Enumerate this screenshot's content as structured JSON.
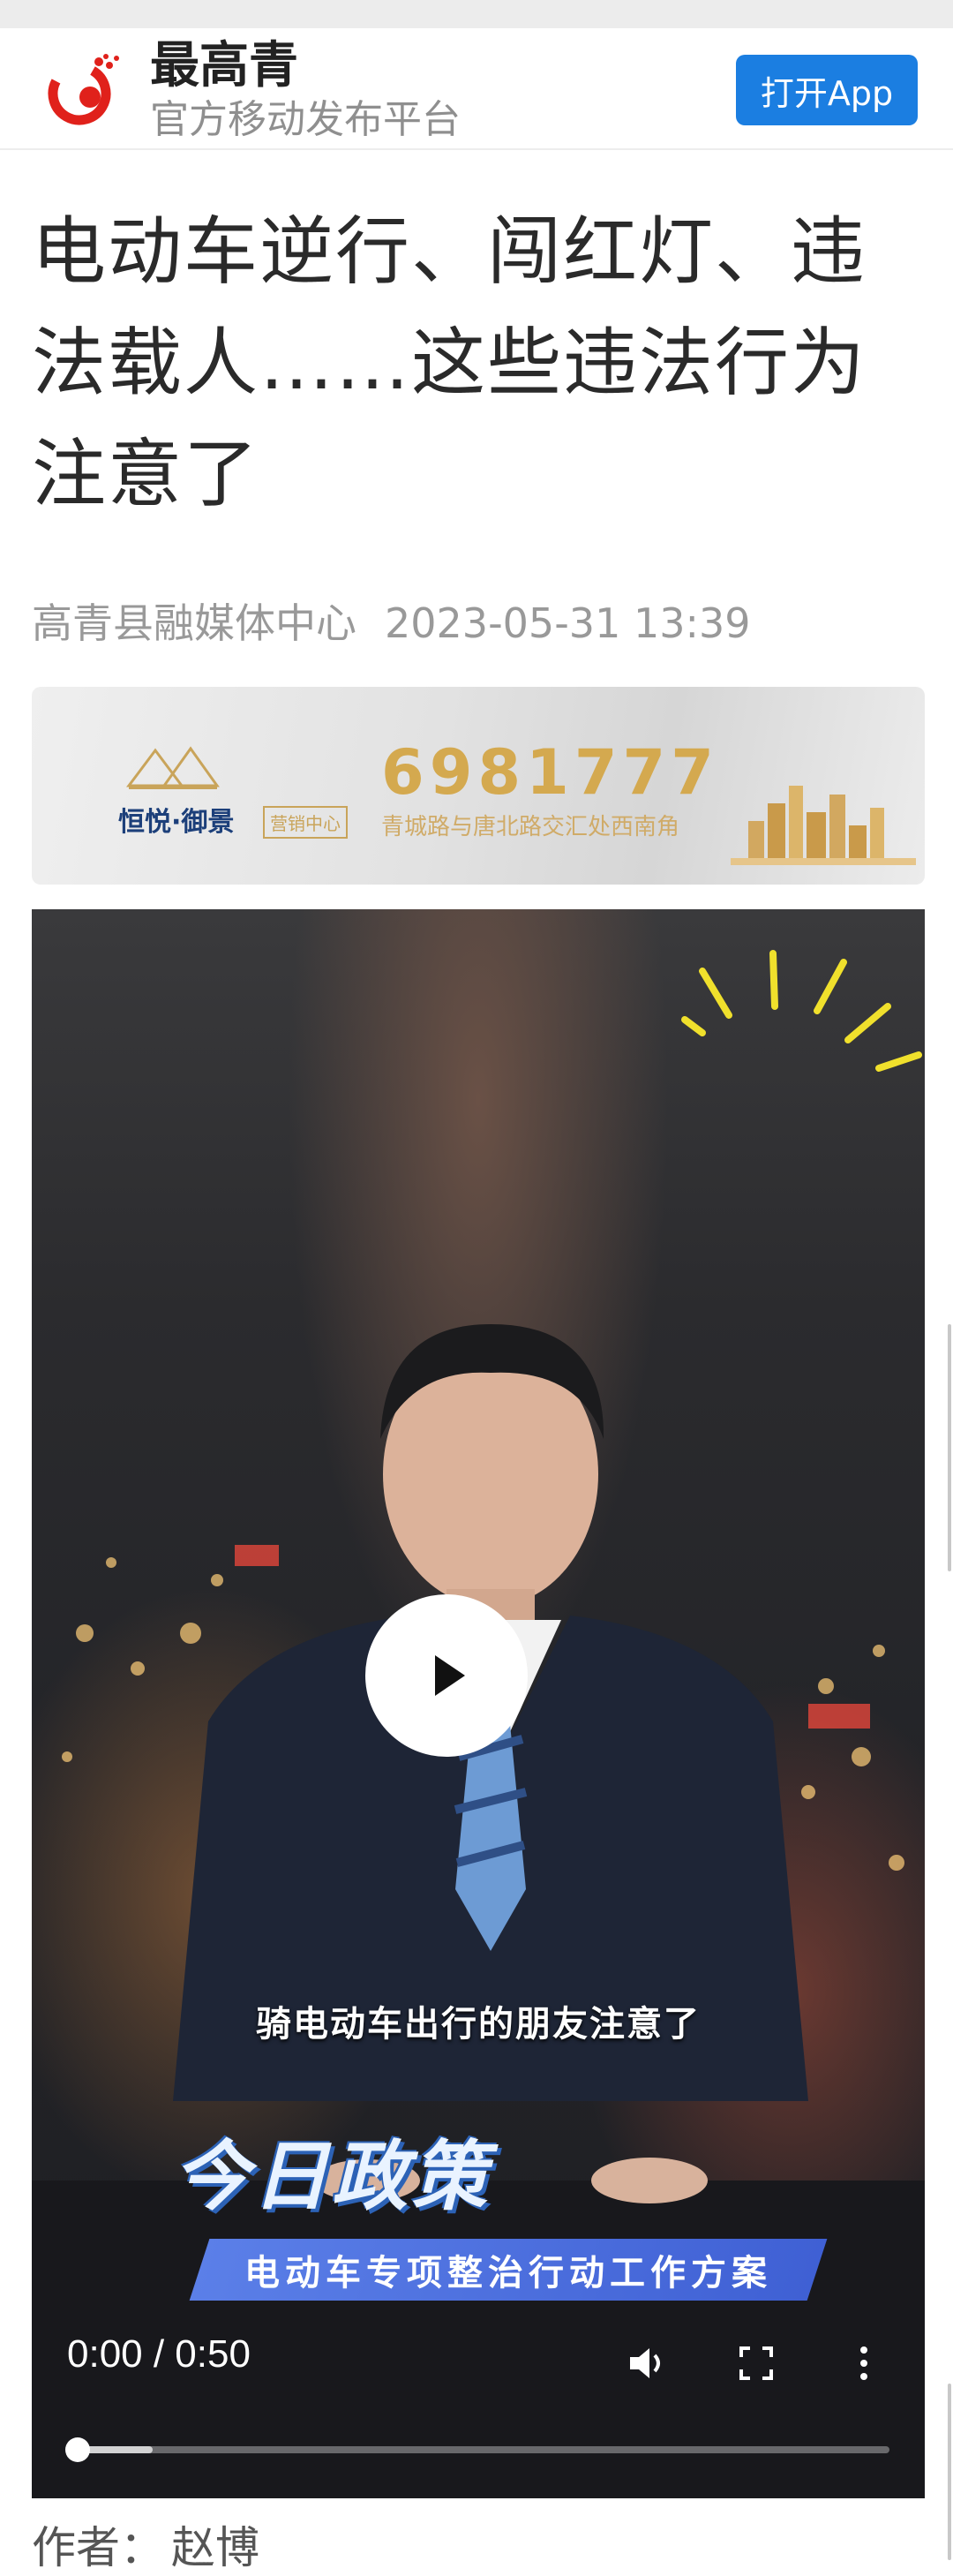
{
  "header": {
    "app_name": "最高青",
    "slogan": "官方移动发布平台",
    "open_app_label": "打开App",
    "brand_color": "#1b7ee1",
    "logo_icon": "app-logo-icon"
  },
  "article": {
    "title": "电动车逆行、闯红灯、违法载人……这些违法行为注意了",
    "source": "高青县融媒体中心",
    "published": "2023-05-31 13:39",
    "author_label": "作者：",
    "author": "赵博"
  },
  "ad": {
    "brand": "恒悦·御景",
    "tag": "营销中心",
    "phone": "6981777",
    "address": "青城路与唐北路交汇处西南角"
  },
  "video": {
    "subtitle": "骑电动车出行的朋友注意了",
    "banner_title": "今日政策",
    "banner_subtitle": "电动车专项整治行动工作方案",
    "time": "0:00 / 0:50",
    "progress": 0.0,
    "buffered": 0.09,
    "icons": [
      "play-icon",
      "volume-icon",
      "fullscreen-icon",
      "more-vertical-icon"
    ]
  }
}
